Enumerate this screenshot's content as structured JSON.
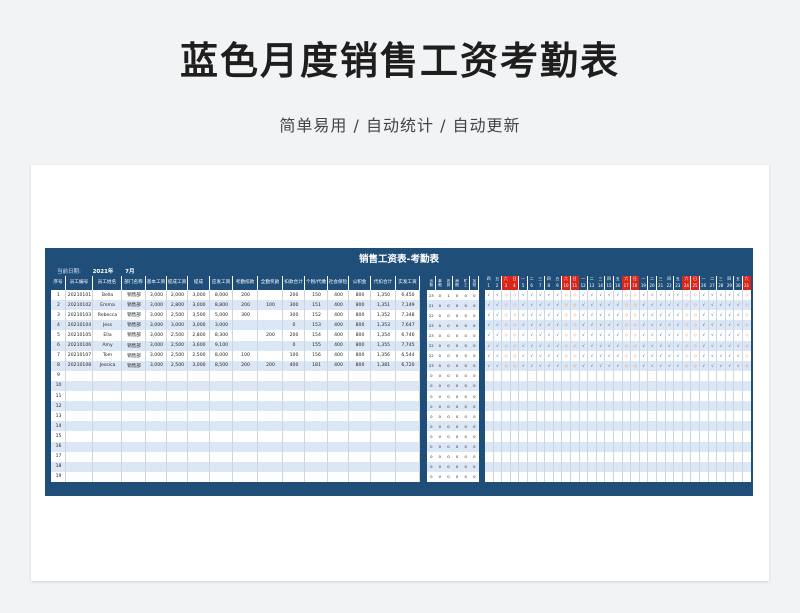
{
  "page": {
    "title": "蓝色月度销售工资考勤表",
    "subtitle": "简单易用  /  自动统计  /  自动更新"
  },
  "sheet": {
    "title": "销售工资表-考勤表",
    "date_label": "当前日期:",
    "year": "2021年",
    "month": "7月"
  },
  "salary_table": {
    "headers": [
      "序号",
      "员工编号",
      "员工姓名",
      "部门名称",
      "基本工资",
      "提成工资",
      "提成",
      "应发工资",
      "考勤扣款",
      "全勤奖励",
      "扣款合计",
      "个税/代缴",
      "社会保险",
      "公积金",
      "代扣合计",
      "实发工资"
    ],
    "rows": [
      [
        "1",
        "20210101",
        "Bella",
        "销售部",
        "3,000",
        "2,000",
        "3,000",
        "8,000",
        "200",
        "",
        "200",
        "150",
        "400",
        "800",
        "1,350",
        "6,450"
      ],
      [
        "2",
        "20210102",
        "Emma",
        "销售部",
        "3,000",
        "2,800",
        "3,000",
        "8,800",
        "200",
        "100",
        "300",
        "151",
        "400",
        "800",
        "1,351",
        "7,149"
      ],
      [
        "3",
        "20210103",
        "Rebecca",
        "销售部",
        "3,000",
        "2,500",
        "3,500",
        "5,000",
        "300",
        "",
        "300",
        "152",
        "400",
        "800",
        "1,352",
        "7,348"
      ],
      [
        "4",
        "20210104",
        "Jess",
        "销售部",
        "3,000",
        "3,000",
        "3,000",
        "3,000",
        "",
        "",
        "0",
        "153",
        "400",
        "800",
        "1,353",
        "7,647"
      ],
      [
        "5",
        "20210105",
        "Ella",
        "销售部",
        "3,000",
        "2,500",
        "2,800",
        "8,300",
        "",
        "200",
        "200",
        "154",
        "400",
        "800",
        "1,354",
        "6,746"
      ],
      [
        "6",
        "20210106",
        "Amy",
        "销售部",
        "3,000",
        "2,500",
        "3,600",
        "9,100",
        "",
        "",
        "0",
        "155",
        "400",
        "800",
        "1,355",
        "7,745"
      ],
      [
        "7",
        "20210107",
        "Tom",
        "销售部",
        "3,000",
        "2,500",
        "2,500",
        "8,000",
        "100",
        "",
        "100",
        "156",
        "400",
        "800",
        "1,356",
        "6,544"
      ],
      [
        "8",
        "20210108",
        "Jessica",
        "销售部",
        "3,000",
        "2,500",
        "3,000",
        "8,500",
        "200",
        "200",
        "400",
        "181",
        "400",
        "800",
        "1,381",
        "6,720"
      ],
      [
        "9",
        "",
        "",
        "",
        "",
        "",
        "",
        "",
        "",
        "",
        "",
        "",
        "",
        "",
        "",
        ""
      ],
      [
        "10",
        "",
        "",
        "",
        "",
        "",
        "",
        "",
        "",
        "",
        "",
        "",
        "",
        "",
        "",
        ""
      ],
      [
        "11",
        "",
        "",
        "",
        "",
        "",
        "",
        "",
        "",
        "",
        "",
        "",
        "",
        "",
        "",
        ""
      ],
      [
        "12",
        "",
        "",
        "",
        "",
        "",
        "",
        "",
        "",
        "",
        "",
        "",
        "",
        "",
        "",
        ""
      ],
      [
        "13",
        "",
        "",
        "",
        "",
        "",
        "",
        "",
        "",
        "",
        "",
        "",
        "",
        "",
        "",
        ""
      ],
      [
        "14",
        "",
        "",
        "",
        "",
        "",
        "",
        "",
        "",
        "",
        "",
        "",
        "",
        "",
        "",
        ""
      ],
      [
        "15",
        "",
        "",
        "",
        "",
        "",
        "",
        "",
        "",
        "",
        "",
        "",
        "",
        "",
        "",
        ""
      ],
      [
        "16",
        "",
        "",
        "",
        "",
        "",
        "",
        "",
        "",
        "",
        "",
        "",
        "",
        "",
        "",
        ""
      ],
      [
        "17",
        "",
        "",
        "",
        "",
        "",
        "",
        "",
        "",
        "",
        "",
        "",
        "",
        "",
        "",
        ""
      ],
      [
        "18",
        "",
        "",
        "",
        "",
        "",
        "",
        "",
        "",
        "",
        "",
        "",
        "",
        "",
        "",
        ""
      ],
      [
        "19",
        "",
        "",
        "",
        "",
        "",
        "",
        "",
        "",
        "",
        "",
        "",
        "",
        "",
        "",
        ""
      ]
    ]
  },
  "stats_table": {
    "headers": [
      "出勤",
      "事假",
      "迟到",
      "病假",
      "旷工",
      "加班"
    ],
    "rows": [
      [
        "23",
        "0",
        "1",
        "0",
        "0",
        "0"
      ],
      [
        "21",
        "0",
        "0",
        "0",
        "0",
        "0"
      ],
      [
        "22",
        "0",
        "0",
        "0",
        "0",
        "0"
      ],
      [
        "23",
        "0",
        "0",
        "0",
        "0",
        "0"
      ],
      [
        "23",
        "0",
        "0",
        "0",
        "0",
        "0"
      ],
      [
        "22",
        "0",
        "0",
        "0",
        "0",
        "0"
      ],
      [
        "22",
        "0",
        "0",
        "0",
        "0",
        "0"
      ],
      [
        "23",
        "0",
        "0",
        "0",
        "0",
        "0"
      ],
      [
        "0",
        "0",
        "0",
        "0",
        "0",
        "0"
      ],
      [
        "0",
        "0",
        "0",
        "0",
        "0",
        "0"
      ],
      [
        "0",
        "0",
        "0",
        "0",
        "0",
        "0"
      ],
      [
        "0",
        "0",
        "0",
        "0",
        "0",
        "0"
      ],
      [
        "0",
        "0",
        "0",
        "0",
        "0",
        "0"
      ],
      [
        "0",
        "0",
        "0",
        "0",
        "0",
        "0"
      ],
      [
        "0",
        "0",
        "0",
        "0",
        "0",
        "0"
      ],
      [
        "0",
        "0",
        "0",
        "0",
        "0",
        "0"
      ],
      [
        "0",
        "0",
        "0",
        "0",
        "0",
        "0"
      ],
      [
        "0",
        "0",
        "0",
        "0",
        "0",
        "0"
      ],
      [
        "0",
        "0",
        "0",
        "0",
        "0",
        "0"
      ]
    ]
  },
  "attendance": {
    "weekdays": [
      "四",
      "五",
      "六",
      "日",
      "一",
      "二",
      "三",
      "四",
      "五",
      "六",
      "日",
      "一",
      "二",
      "三",
      "四",
      "五",
      "六",
      "日",
      "一",
      "二",
      "三",
      "四",
      "五",
      "六",
      "日",
      "一",
      "二",
      "三",
      "四",
      "五",
      "六"
    ],
    "days": [
      "1",
      "2",
      "3",
      "4",
      "5",
      "6",
      "7",
      "8",
      "9",
      "10",
      "11",
      "12",
      "13",
      "14",
      "15",
      "16",
      "17",
      "18",
      "19",
      "20",
      "21",
      "22",
      "23",
      "24",
      "25",
      "26",
      "27",
      "28",
      "29",
      "30",
      "31"
    ],
    "weekend_color": "#d9261c",
    "present_symbol": "√",
    "absent_symbol": "◇",
    "leave_symbol": "△",
    "present_color": "#2a5d9f",
    "absent_color": "#e8732a"
  },
  "colors": {
    "header_bg": "#1f4e79",
    "row_alt": "#dbe7f5",
    "row_plain": "#ffffff"
  }
}
